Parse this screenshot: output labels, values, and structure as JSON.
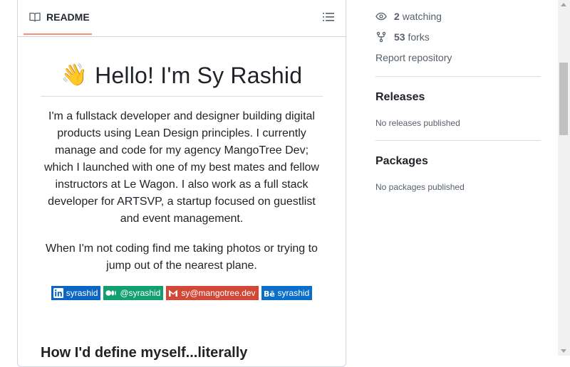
{
  "readme": {
    "tab_label": "README",
    "title": "Hello! I'm Sy Rashid",
    "wave_emoji": "👋",
    "paragraph1": "I'm a fullstack developer and designer building digital products using Lean Design principles. I currently manage and code for my agency MangoTree Dev; which I launched with one of my best mates and fellow instructors at Le Wagon. I also work as a full stack developer for ARTSVP, a startup focused on guestlist and event management.",
    "paragraph2": "When I'm not coding find me taking photos or trying to jump out of the nearest plane.",
    "badges": [
      {
        "icon": "linkedin-icon",
        "label": "syrashid",
        "color": "#0a66c2"
      },
      {
        "icon": "medium-icon",
        "label": "@syrashid",
        "color": "#12a06f"
      },
      {
        "icon": "gmail-icon",
        "label": "sy@mangotree.dev",
        "color": "#d14836"
      },
      {
        "icon": "behance-icon",
        "label": "syrashid",
        "color": "#0b6ec9"
      }
    ],
    "next_heading": "How I'd define myself...literally"
  },
  "sidebar": {
    "watching_count": "2",
    "watching_label": "watching",
    "forks_count": "53",
    "forks_label": "forks",
    "report_label": "Report repository",
    "releases_heading": "Releases",
    "releases_note": "No releases published",
    "packages_heading": "Packages",
    "packages_note": "No packages published"
  }
}
